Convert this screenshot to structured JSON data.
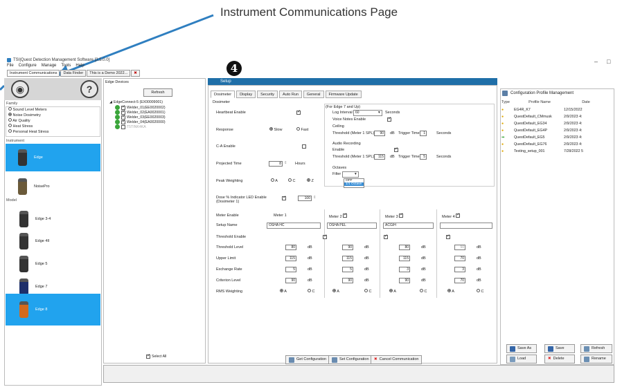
{
  "callout": {
    "text": "Instrument Communications Page",
    "number": "4"
  },
  "window": {
    "title": "TSI|Quest Detection Management Software [3.5.0.0]",
    "menus": [
      "File",
      "Configure",
      "Manage",
      "Tools",
      "Help"
    ],
    "controls": [
      "–",
      "□"
    ]
  },
  "doc_tabs": [
    "Instrument Communications",
    "Data Finder",
    "This is a Demo 2022...",
    "✖"
  ],
  "left": {
    "family_label": "Family",
    "families": [
      "Sound Level Meters",
      "Noise Dosimetry",
      "Air Quality",
      "Heat Stress",
      "Personal Heat Stress"
    ],
    "instrument_label": "Instrument",
    "instruments": [
      "Edge",
      "NoisePro"
    ],
    "model_label": "Model",
    "models": [
      "Edge 3-4",
      "Edge 4II",
      "Edge 5",
      "Edge 7",
      "Edge 8"
    ]
  },
  "edge": {
    "title": "Edge Devices",
    "refresh": "Refresh",
    "root": "EdgeConnect-5 (EX00009001)",
    "devices": [
      "Welder_01(EE0020002)",
      "Welder_02(EA0020001)",
      "Welder_03(EE0020003)",
      "Welder_04(EA0020000)",
      "T5TINK4KA"
    ],
    "select_all": "Select All"
  },
  "setup": {
    "title": "Setup",
    "tabs": [
      "Dosimeter",
      "Display",
      "Security",
      "Auto Run",
      "General",
      "Firmware Update"
    ],
    "section": "Dosimeter",
    "heartbeat_enable": "Heartbeat Enable",
    "response": "Response",
    "slow": "Slow",
    "fast": "Fast",
    "ca_enable": "C-A Enable",
    "projected_time": "Projected Time",
    "projected_value": "8",
    "hours": "Hours",
    "peak_weighting": "Peak Weighting",
    "peak_opts": [
      "A",
      "C",
      "Z"
    ],
    "dose_indicator": "Dose % Indicator LED Enable (Dosimeter 1)",
    "dose_value": "100",
    "edge7_label": "(For Edge 7 and Up)",
    "log_interval": "Log Interval",
    "log_value": "60",
    "seconds": "Seconds",
    "voice_notes": "Voice Notes Enable",
    "ceiling": "Ceiling",
    "threshold_meter": "Threshold (Meter 1 SPL)",
    "ceiling_threshold": "90",
    "db": "dB",
    "trigger_time": "Trigger Time",
    "ceiling_trigger": "1",
    "audio_recording": "Audio Recording",
    "enable": "Enable",
    "audio_threshold": "115",
    "audio_trigger": "5",
    "octaves": "Octaves",
    "filter": "Filter",
    "filter_options": [
      "OFF",
      "1/1 Octave"
    ],
    "meter_enable": "Meter Enable",
    "meters": [
      "Meter 1",
      "Meter 2",
      "Meter 3",
      "Meter 4"
    ],
    "setup_name": "Setup Name",
    "setup_names": [
      "OSHA HC",
      "OSHA PEL",
      "ACGIH",
      ""
    ],
    "threshold_enable": "Threshold Enable",
    "threshold_level": "Threshold Level",
    "threshold_levels": [
      "80",
      "90",
      "80",
      "50"
    ],
    "upper_limit": "Upper Limit",
    "upper_limits": [
      "115",
      "115",
      "115",
      "70"
    ],
    "exchange_rate": "Exchange Rate",
    "exchange_rates": [
      "5",
      "5",
      "3",
      "3"
    ],
    "criterion_level": "Criterion Level",
    "criterion_levels": [
      "90",
      "90",
      "90",
      "70"
    ],
    "rms_weighting": "RMS Weighting",
    "rms_a": "A",
    "rms_c": "C",
    "get_config": "Get Configuration",
    "set_config": "Set Configuration",
    "cancel_comm": "Cancel Communication"
  },
  "config": {
    "title": "Configuration Profile Management",
    "headers": [
      "Type",
      "Profile Name",
      "Date"
    ],
    "rows": [
      [
        "EG4R_K7",
        "12/15/2022"
      ],
      [
        "QuestDefault_CMmusk",
        "2/9/2023 4:"
      ],
      [
        "QuestDefault_EG34",
        "2/9/2023 4:"
      ],
      [
        "QuestDefault_EG4P",
        "2/9/2023 4:"
      ],
      [
        "QuestDefault_EG5",
        "2/9/2023 4:"
      ],
      [
        "QuestDefault_EG76",
        "2/9/2023 4:"
      ],
      [
        "Testing_setup_001",
        "7/28/2022 5"
      ]
    ],
    "save_as": "Save As",
    "save": "Save",
    "refresh": "Refresh",
    "load": "Load",
    "delete": "Delete",
    "rename": "Rename"
  },
  "colors": {
    "accent": "#21a3ee",
    "header": "#1f6fa8",
    "arrow": "#2f7fc0"
  }
}
